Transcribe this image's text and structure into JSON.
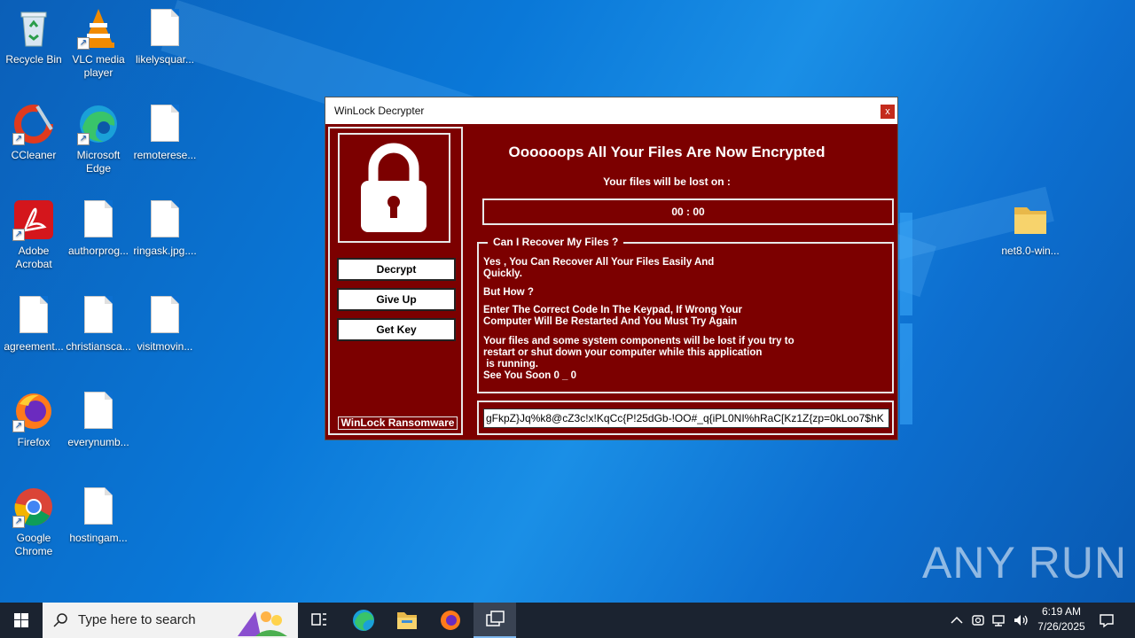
{
  "desktop": {
    "icons": [
      {
        "label": "Recycle Bin",
        "icon": "recycle-bin-icon"
      },
      {
        "label": "VLC media player",
        "icon": "vlc-icon"
      },
      {
        "label": "likelysquar...",
        "icon": "file-icon"
      },
      {
        "label": "CCleaner",
        "icon": "ccleaner-icon"
      },
      {
        "label": "Microsoft Edge",
        "icon": "edge-icon"
      },
      {
        "label": "remoterese...",
        "icon": "file-icon"
      },
      {
        "label": "Adobe Acrobat",
        "icon": "acrobat-icon"
      },
      {
        "label": "authorprog...",
        "icon": "file-icon"
      },
      {
        "label": "ringask.jpg....",
        "icon": "file-icon"
      },
      {
        "label": "agreement...",
        "icon": "file-icon"
      },
      {
        "label": "christiansca...",
        "icon": "file-icon"
      },
      {
        "label": "visitmovin...",
        "icon": "file-icon"
      },
      {
        "label": "Firefox",
        "icon": "firefox-icon"
      },
      {
        "label": "everynumb...",
        "icon": "file-icon"
      },
      {
        "label": "Google Chrome",
        "icon": "chrome-icon"
      },
      {
        "label": "hostingam...",
        "icon": "file-icon"
      },
      {
        "label": "net8.0-win...",
        "icon": "folder-icon"
      }
    ]
  },
  "dialog": {
    "title": "WinLock Decrypter",
    "close_label": "x",
    "headline": "Oooooops All Your Files Are Now Encrypted",
    "subline": "Your files will be lost on :",
    "timer": "00 : 00",
    "buttons": {
      "decrypt": "Decrypt",
      "give_up": "Give Up",
      "get_key": "Get Key"
    },
    "brand": "WinLock Ransomware",
    "group": {
      "legend": "Can I Recover My Files ?",
      "p1": "Yes , You Can Recover All Your Files Easily And\nQuickly.",
      "p2": "But How ?",
      "p3": "Enter The Correct Code In The Keypad, If Wrong Your\nComputer Will Be Restarted And You Must Try Again",
      "p4": "Your files and some system components will be lost if you try to\nrestart or shut down your computer while this application\n is running.\nSee You Soon 0 _ 0"
    },
    "key_value": "gFkpZ}Jq%k8@cZ3c!x!KqCc{P!25dGb-!OO#_q{iPL0NI%hRaC[Kz1Z{zp=0kLoo7$hK"
  },
  "taskbar": {
    "search_placeholder": "Type here to search",
    "time": "6:19 AM",
    "date": "7/26/2025"
  },
  "watermark": "ANY RUN",
  "colors": {
    "dialog_bg": "#7c0000",
    "taskbar_bg": "#1b2330",
    "desktop_bg": "#0a78d8"
  }
}
